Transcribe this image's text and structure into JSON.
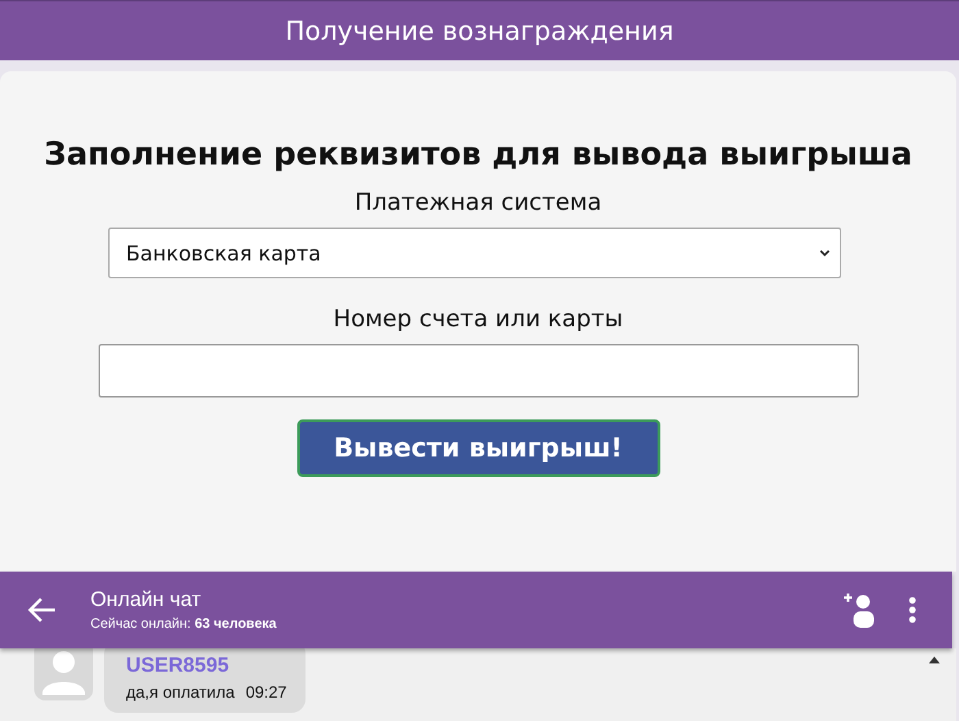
{
  "header": {
    "title": "Получение вознаграждения"
  },
  "form": {
    "title": "Заполнение реквизитов для вывода выигрыша",
    "payment_label": "Платежная система",
    "payment_value": "Банковская карта",
    "account_label": "Номер счета или карты",
    "submit": "Вывести выигрыш!"
  },
  "chat": {
    "title": "Онлайн чат",
    "online": "Сейчас онлайн: **63 человека**",
    "messages": [
      {
        "user": "USER8595",
        "text": "да,я оплатила",
        "time": "09:27"
      }
    ]
  }
}
